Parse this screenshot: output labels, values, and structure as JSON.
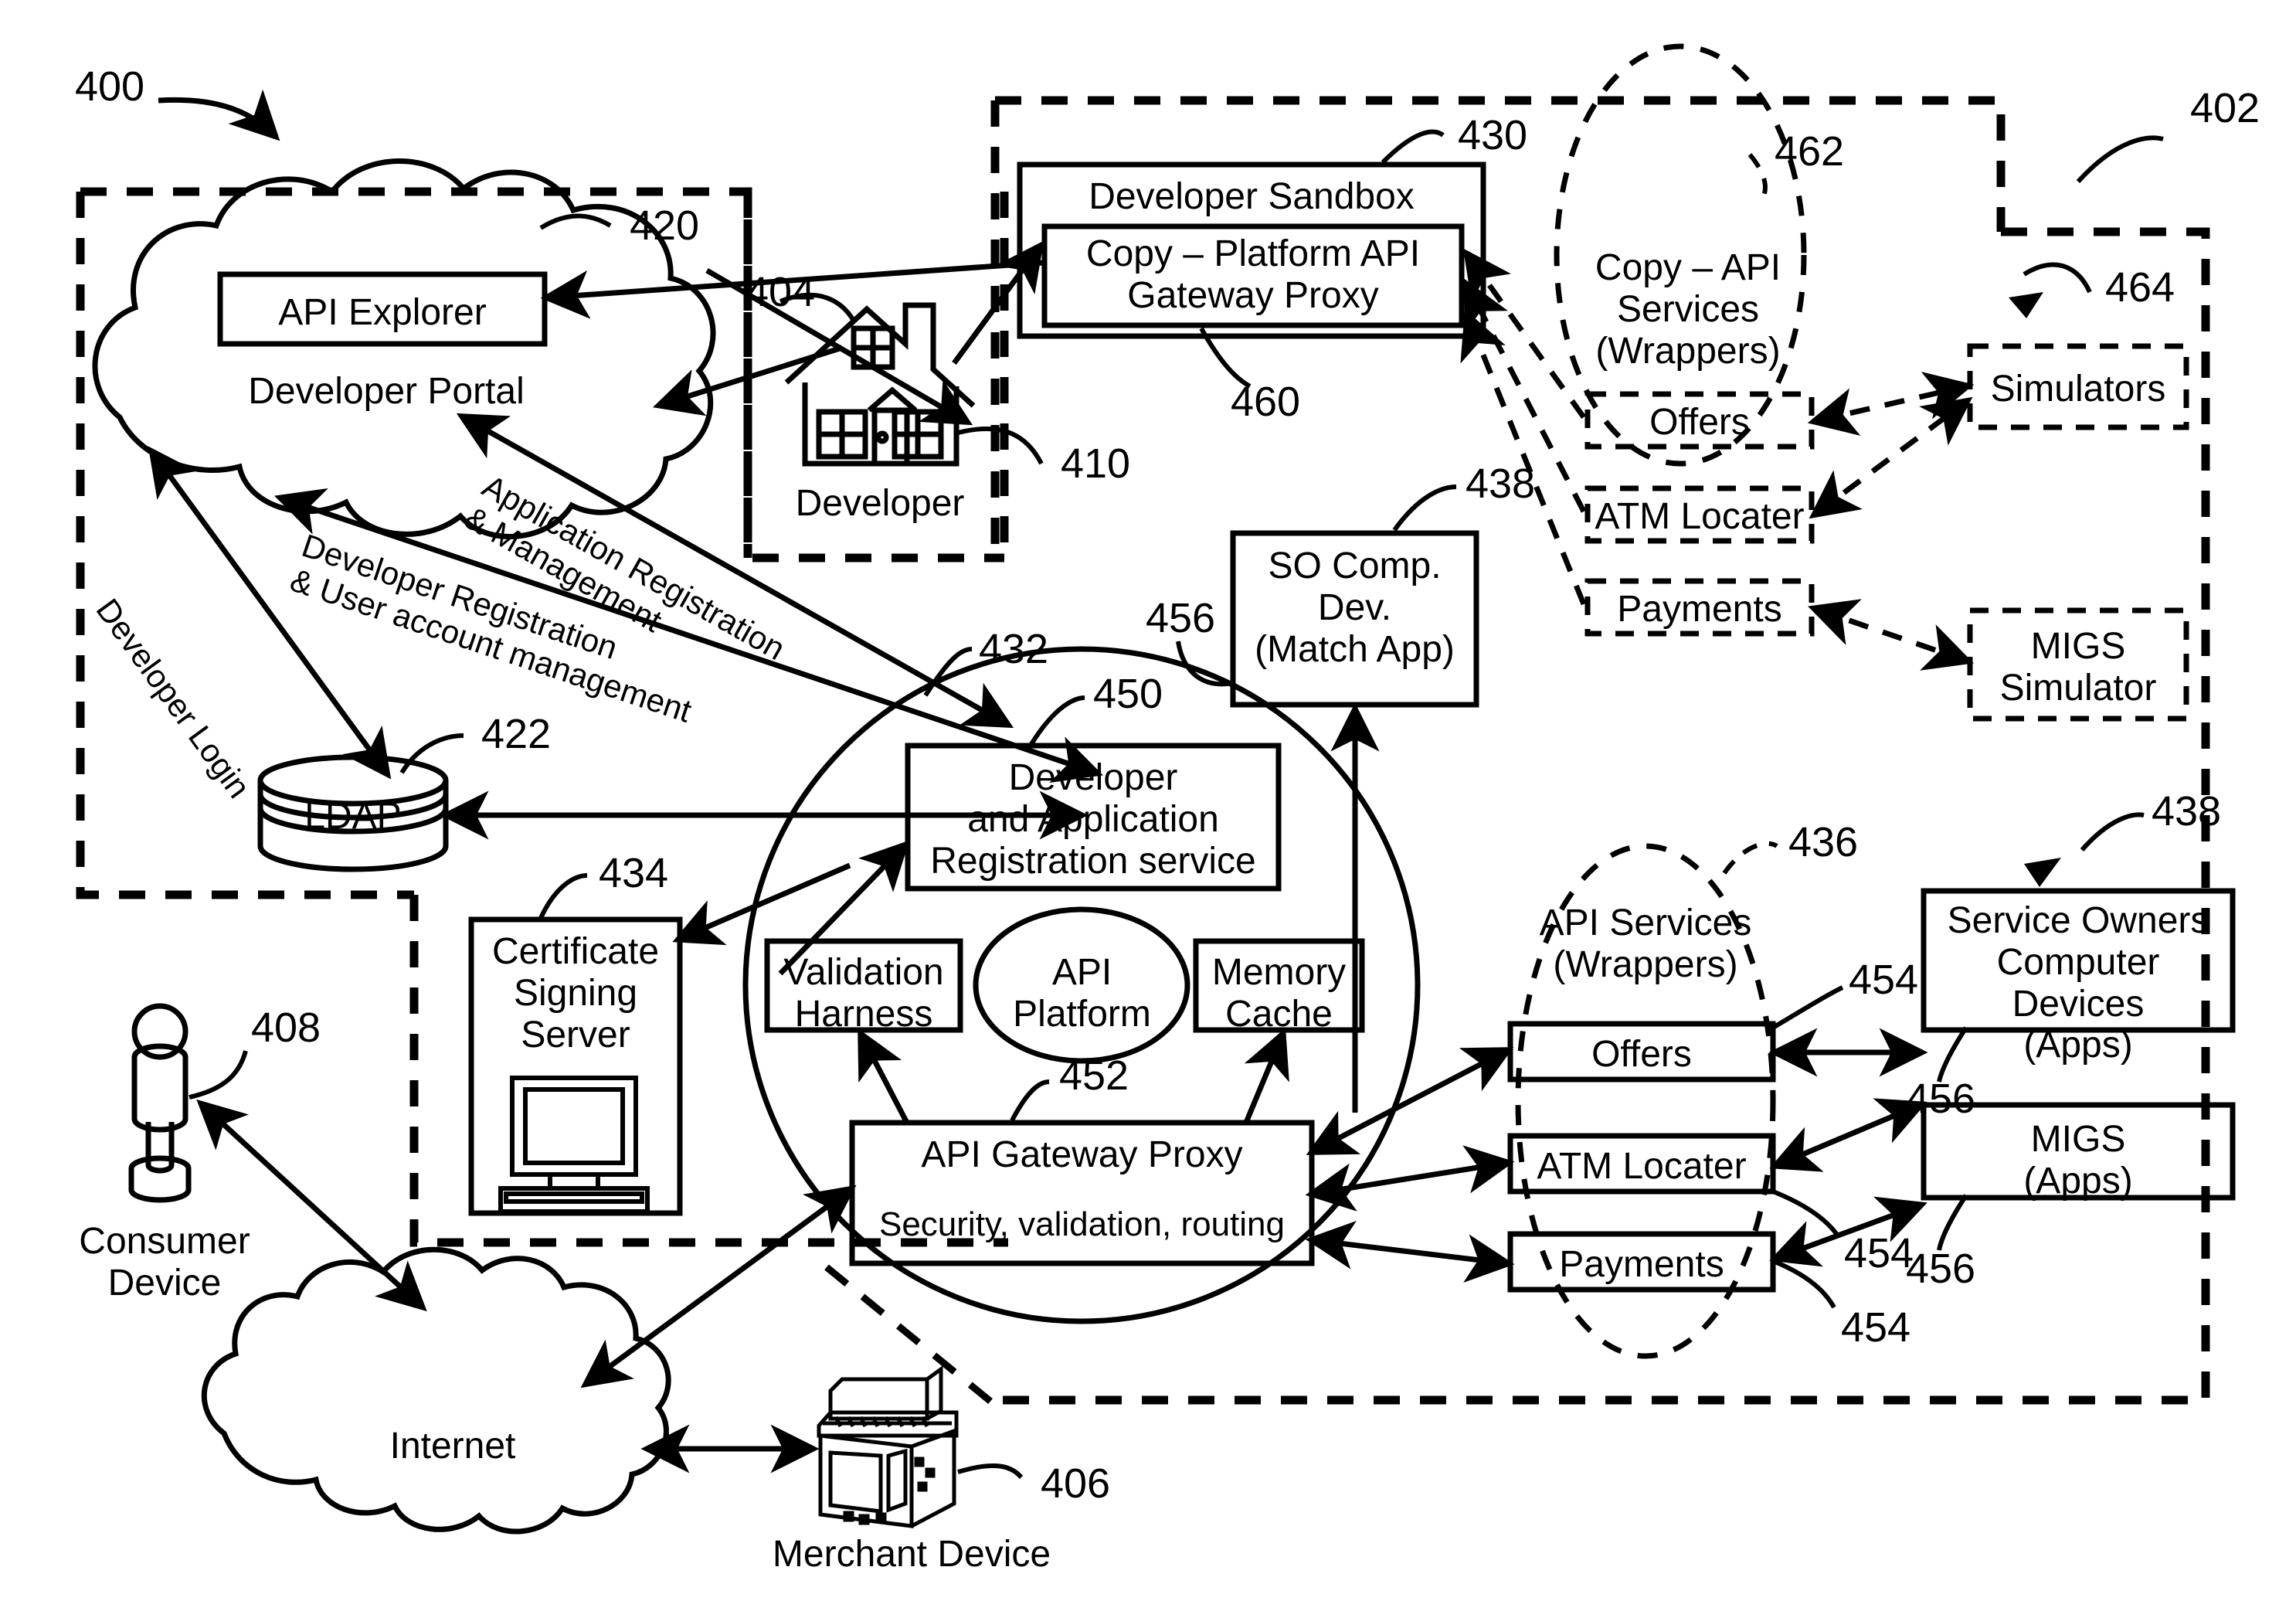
{
  "figure": {
    "reference_numerals": {
      "system": "400",
      "provider_domain": "402",
      "developer_domain": "404",
      "merchant_device": "406",
      "consumer_device": "408",
      "developer": "410",
      "developer_portal": "420",
      "ldap": "422",
      "developer_sandbox": "430",
      "api_platform": "432",
      "certificate_signing_server": "434",
      "api_services_group": "436",
      "so_comp_dev": "438",
      "service_owners_devices": "438",
      "dev_app_registration_service": "450",
      "api_gateway_proxy": "452",
      "api_service_wrapper": "454",
      "so_computer_device": "456",
      "sandbox_gateway_proxy": "460",
      "copy_api_services_group": "462",
      "simulators": "464"
    }
  },
  "nodes": {
    "developer_portal": {
      "label": "Developer Portal",
      "ref": "420"
    },
    "api_explorer": {
      "label": "API Explorer"
    },
    "ldap": {
      "label": "LDAP",
      "ref": "422"
    },
    "developer": {
      "label": "Developer",
      "ref_house": "404",
      "ref_arrow": "410"
    },
    "developer_sandbox": {
      "label": "Developer Sandbox",
      "ref": "430"
    },
    "sandbox_proxy": {
      "label": "Copy – Platform API\nGateway Proxy",
      "ref": "460"
    },
    "copy_api_services": {
      "label": "Copy – API\nServices\n(Wrappers)",
      "ref": "462"
    },
    "copy_offers": {
      "label": "Offers"
    },
    "copy_atm_locater": {
      "label": "ATM Locater"
    },
    "copy_payments": {
      "label": "Payments"
    },
    "simulators": {
      "label": "Simulators",
      "ref": "464"
    },
    "migs_simulator": {
      "label": "MIGS\nSimulator"
    },
    "so_comp_dev": {
      "label": "SO Comp.\nDev.\n(Match App)",
      "ref_top": "438",
      "ref_left": "456"
    },
    "api_platform_circle": {
      "ref": "432"
    },
    "dev_app_reg_service": {
      "label": "Developer\nand Application\nRegistration service",
      "ref": "450"
    },
    "validation_harness": {
      "label": "Validation\nHarness"
    },
    "api_platform": {
      "label": "API\nPlatform"
    },
    "memory_cache": {
      "label": "Memory\nCache"
    },
    "api_gateway_proxy": {
      "label": "API Gateway Proxy",
      "sublabel": "Security, validation, routing",
      "ref": "452"
    },
    "certificate_signing_server": {
      "label": "Certificate\nSigning\nServer",
      "ref": "434"
    },
    "consumer_device": {
      "label": "Consumer\nDevice",
      "ref": "408"
    },
    "internet": {
      "label": "Internet"
    },
    "merchant_device": {
      "label": "Merchant Device",
      "ref": "406"
    },
    "api_services": {
      "label": "API Services\n(Wrappers)",
      "ref": "436"
    },
    "offers": {
      "label": "Offers",
      "ref": "454"
    },
    "atm_locater": {
      "label": "ATM Locater",
      "ref": "454"
    },
    "payments": {
      "label": "Payments",
      "ref": "454"
    },
    "service_owners_devices": {
      "label": "Service Owners\nComputer\nDevices\n(Apps)",
      "ref_top": "438",
      "ref_bottom": "456"
    },
    "migs_apps": {
      "label": "MIGS\n(Apps)",
      "ref": "456"
    }
  },
  "flow_labels": {
    "developer_login": "Developer Login",
    "application_registration": "Application Registration\n& Management",
    "developer_registration": "Developer Registration\n& User account management"
  },
  "colors": {
    "stroke": "#000000",
    "background": "#ffffff"
  }
}
